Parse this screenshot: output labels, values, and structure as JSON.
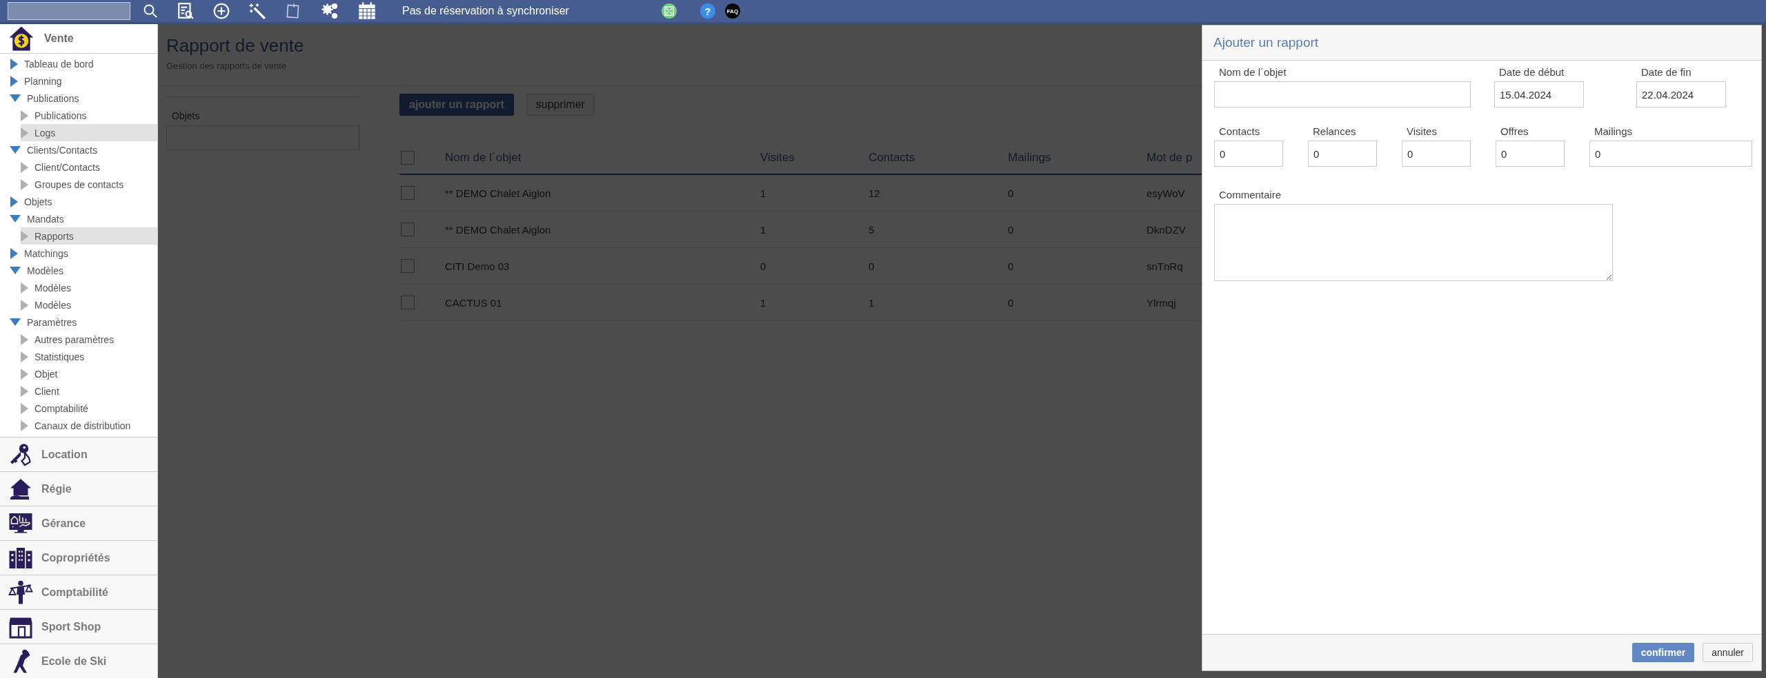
{
  "topbar": {
    "status_text": "Pas de réservation à synchroniser",
    "help_badge": "?",
    "faq_badge": "FAQ"
  },
  "sidebar": {
    "module": {
      "label": "Vente"
    },
    "tree": [
      {
        "label": "Tableau de bord",
        "expanded": false
      },
      {
        "label": "Planning",
        "expanded": false
      },
      {
        "label": "Publications",
        "expanded": true,
        "children": [
          {
            "label": "Publications",
            "selected": false
          },
          {
            "label": "Logs",
            "selected": true
          }
        ]
      },
      {
        "label": "Clients/Contacts",
        "expanded": true,
        "children": [
          {
            "label": "Client/Contacts",
            "selected": false
          },
          {
            "label": "Groupes de contacts",
            "selected": false
          }
        ]
      },
      {
        "label": "Objets",
        "expanded": false
      },
      {
        "label": "Mandats",
        "expanded": true,
        "children": [
          {
            "label": "Rapports",
            "selected": true
          }
        ]
      },
      {
        "label": "Matchings",
        "expanded": false
      },
      {
        "label": "Modèles",
        "expanded": true,
        "children": [
          {
            "label": "Modèles",
            "selected": false
          },
          {
            "label": "Modèles",
            "selected": false
          }
        ]
      },
      {
        "label": "Paramètres",
        "expanded": true,
        "children": [
          {
            "label": "Autres paramètres",
            "selected": false
          },
          {
            "label": "Statistiques",
            "selected": false
          },
          {
            "label": "Objet",
            "selected": false
          },
          {
            "label": "Client",
            "selected": false
          },
          {
            "label": "Comptabilité",
            "selected": false
          },
          {
            "label": "Canaux de distribution",
            "selected": false
          }
        ]
      }
    ],
    "modules": [
      {
        "label": "Location",
        "kind": "keys"
      },
      {
        "label": "Régie",
        "kind": "house"
      },
      {
        "label": "Gérance",
        "kind": "monitor"
      },
      {
        "label": "Copropriétés",
        "kind": "building"
      },
      {
        "label": "Comptabilité",
        "kind": "scale"
      },
      {
        "label": "Sport Shop",
        "kind": "shop"
      },
      {
        "label": "Ecole de Ski",
        "kind": "athlete"
      }
    ]
  },
  "main": {
    "title": "Rapport de vente",
    "subtitle": "Gestion des rapports de vente",
    "filter": {
      "label": "Objets"
    },
    "buttons": [
      {
        "label": "ajouter un rapport",
        "kind": "primary"
      },
      {
        "label": "supprimer",
        "kind": "default"
      }
    ],
    "table": {
      "header_checked": false,
      "columns": [
        "Nom de l´objet",
        "Visites",
        "Contacts",
        "Mailings",
        "Mot de p"
      ],
      "rows": [
        {
          "checked": false,
          "cells": [
            "** DEMO Chalet Aiglon",
            "1",
            "12",
            "0",
            "esyWoV"
          ]
        },
        {
          "checked": false,
          "cells": [
            "** DEMO Chalet Aiglon",
            "1",
            "5",
            "0",
            "DknDZV"
          ]
        },
        {
          "checked": false,
          "cells": [
            "CITI Demo 03",
            "0",
            "0",
            "0",
            "snTnRq"
          ]
        },
        {
          "checked": false,
          "cells": [
            "CACTUS 01",
            "1",
            "1",
            "0",
            "Ylrmqj"
          ]
        }
      ]
    }
  },
  "dialog": {
    "title": "Ajouter un rapport",
    "fields": [
      {
        "label": "Nom de l´objet"
      },
      {
        "label": "Date de début",
        "value": "15.04.2024"
      },
      {
        "label": "Date de fin",
        "value": "22.04.2024"
      }
    ],
    "counts": [
      {
        "label": "Contacts",
        "value": "0"
      },
      {
        "label": "Relances",
        "value": "0"
      },
      {
        "label": "Visites",
        "value": "0"
      },
      {
        "label": "Offres",
        "value": "0"
      },
      {
        "label": "Mailings",
        "value": "0"
      }
    ],
    "comment": {
      "label": "Commentaire"
    },
    "buttons": [
      {
        "label": "confirmer",
        "kind": "primary"
      },
      {
        "label": "annuler",
        "kind": "default"
      }
    ]
  }
}
